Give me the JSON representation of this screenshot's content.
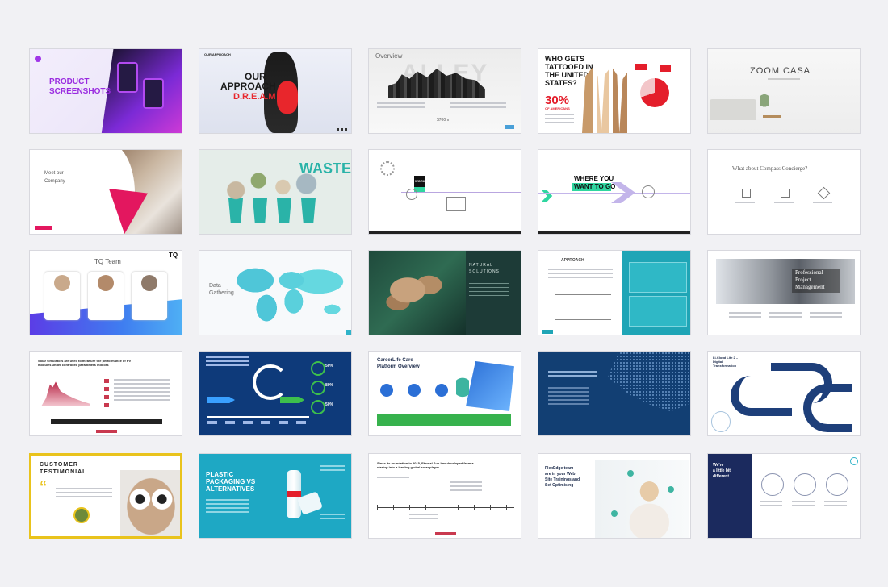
{
  "slides": {
    "s1": {
      "title_line1": "PRODUCT",
      "title_line2": "SCREENSHOTS"
    },
    "s2": {
      "tag": "OUR APPROACH",
      "title_line1": "OUR",
      "title_line2": "APPROACH",
      "title_line3": "D.R.E.A.M"
    },
    "s3": {
      "title": "Overview",
      "bg_word": "ALLEY",
      "price": "$700m"
    },
    "s4": {
      "title_line1": "WHO GETS",
      "title_line2": "TATTOOED IN",
      "title_line3": "THE UNITED",
      "title_line4": "STATES?",
      "stat": "30%",
      "stat_caption": "OF AMERICANS"
    },
    "s5": {
      "brand": "ZOOM CASA"
    },
    "s6": {
      "title_line1": "Meet our",
      "title_line2": "Company"
    },
    "s7": {
      "title": "WASTE"
    },
    "s8": {
      "label": "WORK"
    },
    "s9": {
      "title_line1": "WHERE YOU",
      "title_line2": "WANT TO GO"
    },
    "s10": {
      "title": "What about Compass Concierge?"
    },
    "s11": {
      "title": "TQ Team",
      "logo": "TQ"
    },
    "s12": {
      "title_line1": "Data",
      "title_line2": "Gathering"
    },
    "s13": {
      "title_line1": "NATURAL",
      "title_line2": "SOLUTIONS"
    },
    "s14": {
      "title": "APPROACH"
    },
    "s15": {
      "title_line1": "Professional",
      "title_line2": "Project",
      "title_line3": "Management"
    },
    "s16": {
      "title_line1": "Solar simulators are used to measure the performance of PV",
      "title_line2": "modules under controlled parameters indoors"
    },
    "s17": {
      "pct1": "50%",
      "pct2": "80%",
      "pct3": "50%"
    },
    "s18": {
      "title_line1": "CareerLife Care",
      "title_line2": "Platform Overview"
    },
    "s20": {
      "title_line1": "Li-Cloud Lite 2 –",
      "title_line2": "Digital",
      "title_line3": "Transformation"
    },
    "s21": {
      "title_line1": "CUSTOMER",
      "title_line2": "TESTIMONIAL",
      "quote_mark": "“"
    },
    "s22": {
      "title_line1": "PLASTIC",
      "title_line2": "PACKAGING VS",
      "title_line3": "ALTERNATIVES"
    },
    "s23": {
      "title_line1": "Since its foundation in 2015, Eternal Sun has developed from a",
      "title_line2": "startup into a leading global solar player"
    },
    "s24": {
      "title_line1": "FlexEdge team",
      "title_line2": "are in your Web",
      "title_line3": "Site Trainings and",
      "title_line4": "Set Optimising"
    },
    "s25": {
      "title_line1": "We're",
      "title_line2": "a little bit",
      "title_line3": "different..."
    }
  }
}
